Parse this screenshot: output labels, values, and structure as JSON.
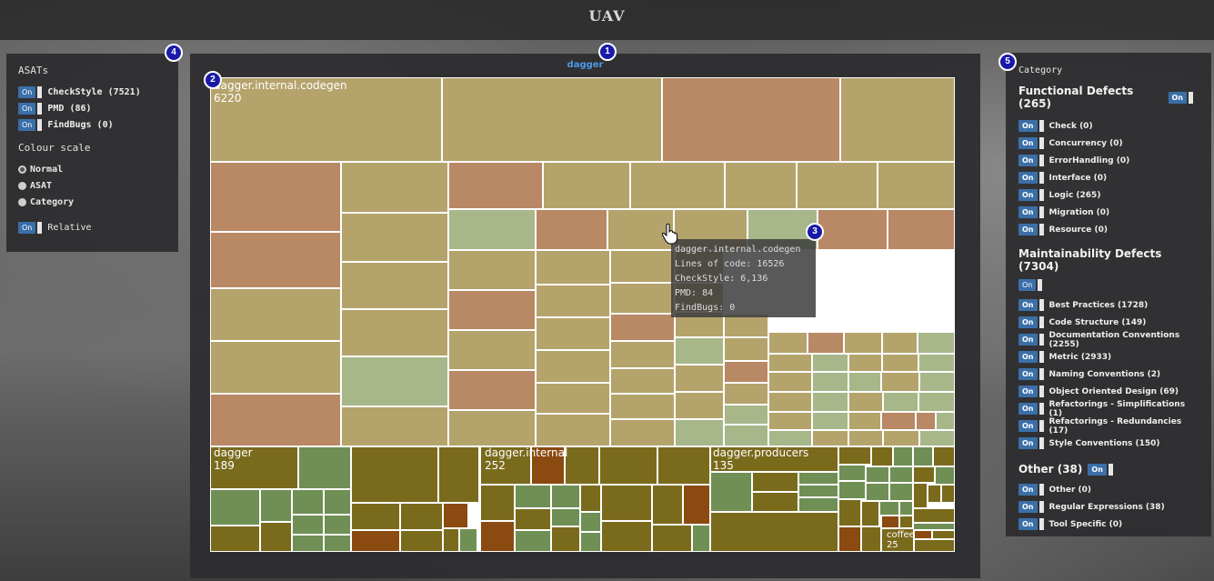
{
  "app": {
    "title": "UAV"
  },
  "treemap": {
    "title": "dagger",
    "labels": [
      {
        "name": "dagger.internal.codegen",
        "count": "6220"
      },
      {
        "name": "dagger",
        "count": "189"
      },
      {
        "name": "dagger.internal",
        "count": "252"
      },
      {
        "name": "dagger.producers",
        "count": "135"
      },
      {
        "name": "coffee",
        "count": "25"
      }
    ]
  },
  "tooltip": {
    "name": "dagger.internal.codegen",
    "loc": "Lines of code: 16526",
    "checkstyle": "CheckStyle: 6,136",
    "pmd": "PMD: 84",
    "findbugs": "FindBugs: 0"
  },
  "left": {
    "asats_title": "ASATs",
    "toggle_on": "On",
    "asats": [
      {
        "label": "CheckStyle (7521)"
      },
      {
        "label": "PMD (86)"
      },
      {
        "label": "FindBugs (0)"
      }
    ],
    "colour_scale_title": "Colour scale",
    "scales": [
      {
        "label": "Normal",
        "checked": true
      },
      {
        "label": "ASAT",
        "checked": false
      },
      {
        "label": "Category",
        "checked": false
      }
    ],
    "relative_label": "Relative"
  },
  "right": {
    "title": "Category",
    "groups": [
      {
        "label": "Functional Defects (265)",
        "items": [
          "Check (0)",
          "Concurrency (0)",
          "ErrorHandling (0)",
          "Interface (0)",
          "Logic (265)",
          "Migration (0)",
          "Resource (0)"
        ]
      },
      {
        "label": "Maintainability Defects (7304)",
        "items": [
          "Best Practices (1728)",
          "Code Structure (149)",
          "Documentation Conventions (2255)",
          "Metric (2933)",
          "Naming Conventions (2)",
          "Object Oriented Design (69)",
          "Refactorings - Simplifications (1)",
          "Refactorings - Redundancies (17)",
          "Style Conventions (150)"
        ]
      },
      {
        "label": "Other (38)",
        "items": [
          "Other (0)",
          "Regular Expressions (38)",
          "Tool Specific (0)"
        ]
      }
    ]
  },
  "badges": [
    "1",
    "2",
    "3",
    "4",
    "5"
  ],
  "colors": {
    "tan": "#b5a36c",
    "salmon": "#b98865",
    "sage": "#a7b78a",
    "olive": "#7a6a1c",
    "green": "#6f8f55",
    "rust": "#8a4a10"
  }
}
